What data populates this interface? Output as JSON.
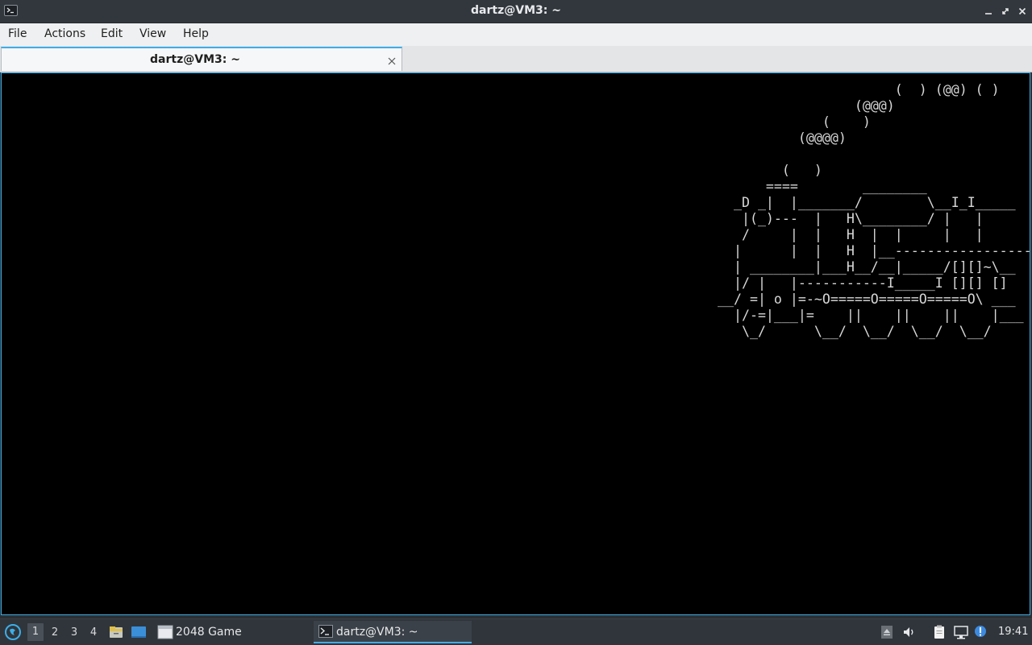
{
  "window": {
    "title": "dartz@VM3: ~"
  },
  "menubar": {
    "items": [
      "File",
      "Actions",
      "Edit",
      "View",
      "Help"
    ]
  },
  "tabs": [
    {
      "label": "dartz@VM3: ~"
    }
  ],
  "terminal": {
    "lines": [
      "                       (  ) (@@) ( )",
      "                  (@@@)",
      "              (    )",
      "           (@@@@)",
      "",
      "         (   )",
      "       ====        ________",
      "   _D _|  |_______/        \\__I_I_____",
      "    |(_)---  |   H\\________/ |   |",
      "    /     |  |   H  |  |     |   |",
      "   |      |  |   H  |__-----------------",
      "   | ________|___H__/__|_____/[][]~\\__",
      "   |/ |   |-----------I_____I [][] []",
      " __/ =| o |=-~O=====O=====O=====O\\ ___",
      "   |/-=|___|=    ||    ||    ||    |___",
      "    \\_/      \\__/  \\__/  \\__/  \\__/"
    ]
  },
  "taskbar": {
    "workspaces": [
      "1",
      "2",
      "3",
      "4"
    ],
    "active_workspace": "1",
    "tasks": [
      {
        "label": "2048 Game",
        "icon": "window-icon"
      },
      {
        "label": "dartz@VM3: ~",
        "icon": "terminal-icon"
      }
    ],
    "clock": "19:41"
  },
  "colors": {
    "accent": "#3daee9",
    "terminal_bg": "#000000",
    "terminal_fg": "#d8d8d8"
  }
}
